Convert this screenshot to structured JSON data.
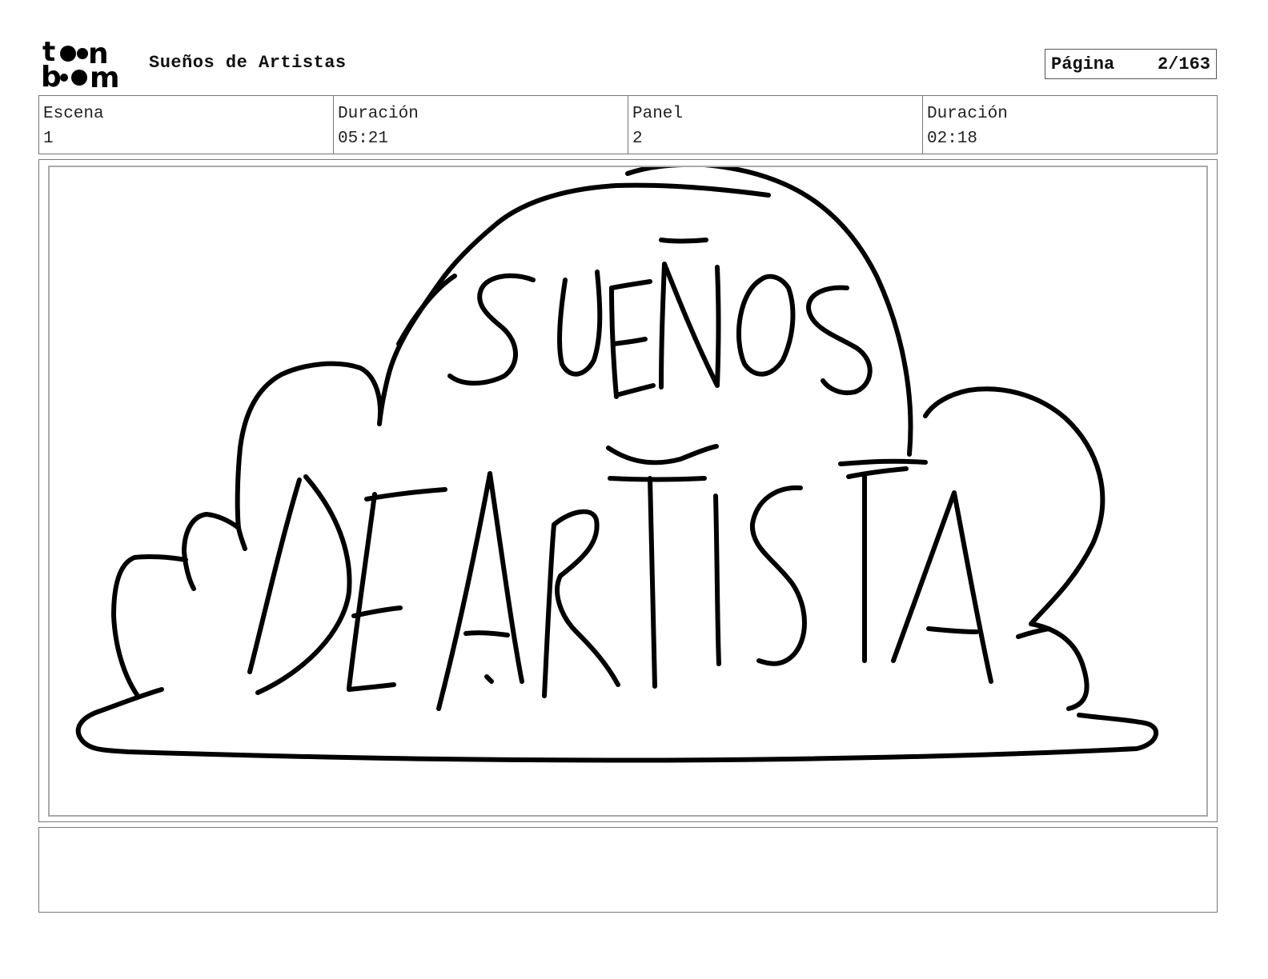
{
  "header": {
    "logo_text_top": "toon",
    "logo_text_bottom": "boom",
    "project_title": "Sueños de Artistas",
    "page_label": "Página",
    "page_value": "2/163"
  },
  "info": {
    "scene_label": "Escena",
    "scene_value": "1",
    "scene_duration_label": "Duración",
    "scene_duration_value": "05:21",
    "panel_label": "Panel",
    "panel_value": "2",
    "panel_duration_label": "Duración",
    "panel_duration_value": "02:18"
  },
  "panel_art": {
    "lettering_top": "SUEÑOS",
    "lettering_bottom": "DEARTISTA"
  },
  "notes": {
    "text": ""
  }
}
